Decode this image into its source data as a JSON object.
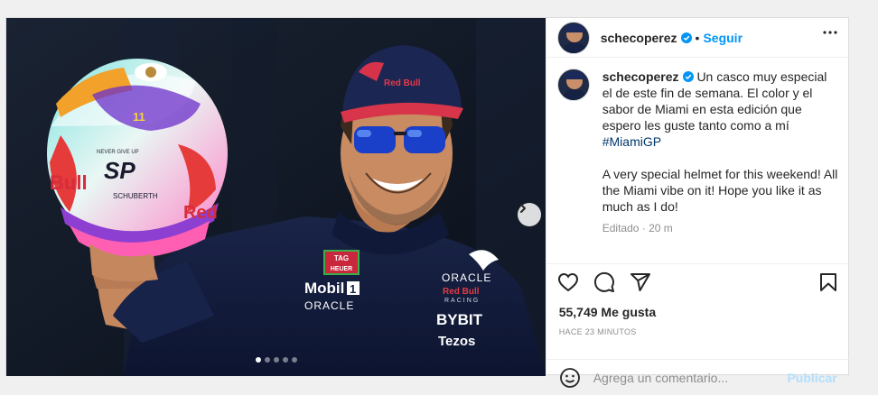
{
  "post": {
    "username": "schecoperez",
    "follow_label": "Seguir",
    "separator": "•",
    "more_icon": "more-horizontal-icon",
    "verified_icon": "verified-badge-icon"
  },
  "caption": {
    "username": "schecoperez",
    "text_es_start": "Un casco muy especial el de este fin de semana. El color y el sabor de Miami en esta edición que espero les guste tanto como a mí ",
    "hashtag": "#MiamiGP",
    "text_en": "A very special helmet for this weekend! All the Miami vibe on it! Hope you like it as much as I do!",
    "edited": "Editado · 20 m"
  },
  "media": {
    "carousel_total": 5,
    "carousel_active": 1,
    "next_icon": "chevron-right-icon",
    "helmet_texts": {
      "brand_left": "Bull",
      "brand_right": "Red",
      "number": "11",
      "motto": "NEVER GIVE UP",
      "logo": "SP",
      "maker": "SCHUBERTH"
    },
    "shirt_texts": {
      "tag": "TAG",
      "tag2": "HEUER",
      "mobil": "Mobil",
      "mobil_num": "1",
      "oracle_chest": "ORACLE",
      "oracle_right": "ORACLE",
      "redbull": "Red Bull",
      "racing": "RACING",
      "bybit": "BYBIT",
      "tezos": "Tezos"
    },
    "cap_text": "Red Bull"
  },
  "actions": {
    "like_icon": "heart-icon",
    "comment_icon": "comment-icon",
    "share_icon": "share-icon",
    "save_icon": "bookmark-icon"
  },
  "likes": "55,749 Me gusta",
  "timestamp": "HACE 23 MINUTOS",
  "comment": {
    "emoji_icon": "emoji-icon",
    "placeholder": "Agrega un comentario...",
    "publish_label": "Publicar"
  }
}
